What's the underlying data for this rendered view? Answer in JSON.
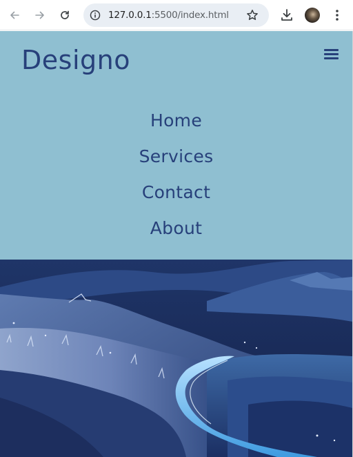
{
  "browser": {
    "url_host": "127.0.0.1",
    "url_rest": ":5500/index.html",
    "back_icon": "arrow-left-icon",
    "forward_icon": "arrow-right-icon",
    "reload_icon": "reload-icon",
    "info_icon": "info-icon",
    "star_icon": "star-icon",
    "download_icon": "download-icon",
    "menu_icon": "three-dots-icon"
  },
  "site": {
    "brand": "Designo",
    "menu_icon": "hamburger-icon",
    "nav": [
      {
        "label": "Home"
      },
      {
        "label": "Services"
      },
      {
        "label": "Contact"
      },
      {
        "label": "About"
      }
    ],
    "hero_image": "night-landscape-illustration"
  },
  "colors": {
    "header_bg": "#8fbfd1",
    "brand_text": "#27407a",
    "hero_dark": "#17244d"
  }
}
